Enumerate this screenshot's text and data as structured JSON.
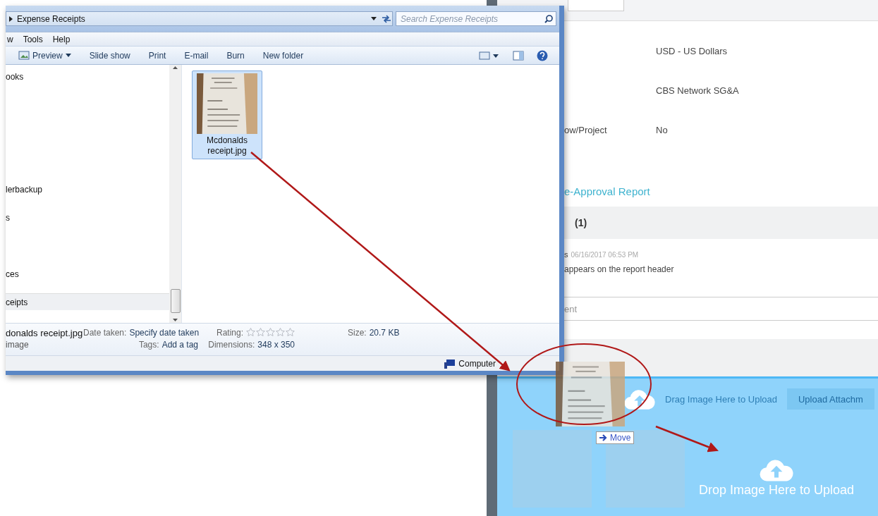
{
  "explorer": {
    "address": "Expense Receipts",
    "search_placeholder": "Search Expense Receipts",
    "menu": [
      "w",
      "Tools",
      "Help"
    ],
    "toolbar": [
      "Preview",
      "Slide show",
      "Print",
      "E-mail",
      "Burn",
      "New folder"
    ],
    "nav_items": [
      {
        "label": "ooks",
        "selected": false
      },
      {
        "label": "lerbackup",
        "selected": false
      },
      {
        "label": "s",
        "selected": false
      },
      {
        "label": "ces",
        "selected": false
      },
      {
        "label": "ceipts",
        "selected": true
      }
    ],
    "files": [
      {
        "name": "Mcdonalds receipt.jpg",
        "selected": true,
        "kind": "picture"
      }
    ],
    "details": {
      "file_name": "donalds receipt.jpg",
      "file_type": "image",
      "fields": [
        {
          "label": "Date taken:",
          "value": "Specify date taken"
        },
        {
          "label": "Tags:",
          "value": "Add a tag"
        }
      ],
      "rating_label": "Rating:",
      "stars": 0,
      "dimensions_label": "Dimensions:",
      "dimensions": "348 x 350",
      "size_label": "Size:",
      "size": "20.7 KB"
    },
    "status": "Computer"
  },
  "report": {
    "rows": [
      {
        "value": "USD - US Dollars"
      },
      {
        "value": "CBS Network SG&A"
      },
      {
        "label": "ow/Project",
        "value": "No"
      }
    ],
    "link": "e-Approval Report",
    "comments_header": "(1)",
    "comment": {
      "author": "s",
      "date": "06/16/2017 06:53 PM",
      "text": "appears on the report header"
    },
    "comment_placeholder": "ent",
    "upload": {
      "hint": "Drag Image Here to Upload",
      "button": "Upload Attachm",
      "drop_text": "Drop Image Here to Upload"
    }
  },
  "drag": {
    "label": "Move"
  }
}
